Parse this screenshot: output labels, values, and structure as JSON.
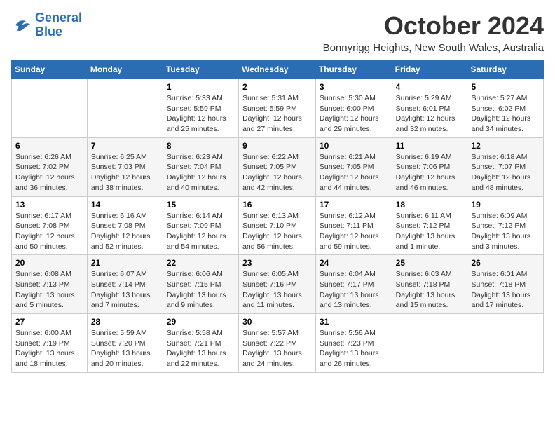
{
  "logo": {
    "line1": "General",
    "line2": "Blue"
  },
  "title": "October 2024",
  "location": "Bonnyrigg Heights, New South Wales, Australia",
  "days_header": [
    "Sunday",
    "Monday",
    "Tuesday",
    "Wednesday",
    "Thursday",
    "Friday",
    "Saturday"
  ],
  "weeks": [
    [
      {
        "day": "",
        "sunrise": "",
        "sunset": "",
        "daylight": ""
      },
      {
        "day": "",
        "sunrise": "",
        "sunset": "",
        "daylight": ""
      },
      {
        "day": "1",
        "sunrise": "Sunrise: 5:33 AM",
        "sunset": "Sunset: 5:59 PM",
        "daylight": "Daylight: 12 hours and 25 minutes."
      },
      {
        "day": "2",
        "sunrise": "Sunrise: 5:31 AM",
        "sunset": "Sunset: 5:59 PM",
        "daylight": "Daylight: 12 hours and 27 minutes."
      },
      {
        "day": "3",
        "sunrise": "Sunrise: 5:30 AM",
        "sunset": "Sunset: 6:00 PM",
        "daylight": "Daylight: 12 hours and 29 minutes."
      },
      {
        "day": "4",
        "sunrise": "Sunrise: 5:29 AM",
        "sunset": "Sunset: 6:01 PM",
        "daylight": "Daylight: 12 hours and 32 minutes."
      },
      {
        "day": "5",
        "sunrise": "Sunrise: 5:27 AM",
        "sunset": "Sunset: 6:02 PM",
        "daylight": "Daylight: 12 hours and 34 minutes."
      }
    ],
    [
      {
        "day": "6",
        "sunrise": "Sunrise: 6:26 AM",
        "sunset": "Sunset: 7:02 PM",
        "daylight": "Daylight: 12 hours and 36 minutes."
      },
      {
        "day": "7",
        "sunrise": "Sunrise: 6:25 AM",
        "sunset": "Sunset: 7:03 PM",
        "daylight": "Daylight: 12 hours and 38 minutes."
      },
      {
        "day": "8",
        "sunrise": "Sunrise: 6:23 AM",
        "sunset": "Sunset: 7:04 PM",
        "daylight": "Daylight: 12 hours and 40 minutes."
      },
      {
        "day": "9",
        "sunrise": "Sunrise: 6:22 AM",
        "sunset": "Sunset: 7:05 PM",
        "daylight": "Daylight: 12 hours and 42 minutes."
      },
      {
        "day": "10",
        "sunrise": "Sunrise: 6:21 AM",
        "sunset": "Sunset: 7:05 PM",
        "daylight": "Daylight: 12 hours and 44 minutes."
      },
      {
        "day": "11",
        "sunrise": "Sunrise: 6:19 AM",
        "sunset": "Sunset: 7:06 PM",
        "daylight": "Daylight: 12 hours and 46 minutes."
      },
      {
        "day": "12",
        "sunrise": "Sunrise: 6:18 AM",
        "sunset": "Sunset: 7:07 PM",
        "daylight": "Daylight: 12 hours and 48 minutes."
      }
    ],
    [
      {
        "day": "13",
        "sunrise": "Sunrise: 6:17 AM",
        "sunset": "Sunset: 7:08 PM",
        "daylight": "Daylight: 12 hours and 50 minutes."
      },
      {
        "day": "14",
        "sunrise": "Sunrise: 6:16 AM",
        "sunset": "Sunset: 7:08 PM",
        "daylight": "Daylight: 12 hours and 52 minutes."
      },
      {
        "day": "15",
        "sunrise": "Sunrise: 6:14 AM",
        "sunset": "Sunset: 7:09 PM",
        "daylight": "Daylight: 12 hours and 54 minutes."
      },
      {
        "day": "16",
        "sunrise": "Sunrise: 6:13 AM",
        "sunset": "Sunset: 7:10 PM",
        "daylight": "Daylight: 12 hours and 56 minutes."
      },
      {
        "day": "17",
        "sunrise": "Sunrise: 6:12 AM",
        "sunset": "Sunset: 7:11 PM",
        "daylight": "Daylight: 12 hours and 59 minutes."
      },
      {
        "day": "18",
        "sunrise": "Sunrise: 6:11 AM",
        "sunset": "Sunset: 7:12 PM",
        "daylight": "Daylight: 13 hours and 1 minute."
      },
      {
        "day": "19",
        "sunrise": "Sunrise: 6:09 AM",
        "sunset": "Sunset: 7:12 PM",
        "daylight": "Daylight: 13 hours and 3 minutes."
      }
    ],
    [
      {
        "day": "20",
        "sunrise": "Sunrise: 6:08 AM",
        "sunset": "Sunset: 7:13 PM",
        "daylight": "Daylight: 13 hours and 5 minutes."
      },
      {
        "day": "21",
        "sunrise": "Sunrise: 6:07 AM",
        "sunset": "Sunset: 7:14 PM",
        "daylight": "Daylight: 13 hours and 7 minutes."
      },
      {
        "day": "22",
        "sunrise": "Sunrise: 6:06 AM",
        "sunset": "Sunset: 7:15 PM",
        "daylight": "Daylight: 13 hours and 9 minutes."
      },
      {
        "day": "23",
        "sunrise": "Sunrise: 6:05 AM",
        "sunset": "Sunset: 7:16 PM",
        "daylight": "Daylight: 13 hours and 11 minutes."
      },
      {
        "day": "24",
        "sunrise": "Sunrise: 6:04 AM",
        "sunset": "Sunset: 7:17 PM",
        "daylight": "Daylight: 13 hours and 13 minutes."
      },
      {
        "day": "25",
        "sunrise": "Sunrise: 6:03 AM",
        "sunset": "Sunset: 7:18 PM",
        "daylight": "Daylight: 13 hours and 15 minutes."
      },
      {
        "day": "26",
        "sunrise": "Sunrise: 6:01 AM",
        "sunset": "Sunset: 7:18 PM",
        "daylight": "Daylight: 13 hours and 17 minutes."
      }
    ],
    [
      {
        "day": "27",
        "sunrise": "Sunrise: 6:00 AM",
        "sunset": "Sunset: 7:19 PM",
        "daylight": "Daylight: 13 hours and 18 minutes."
      },
      {
        "day": "28",
        "sunrise": "Sunrise: 5:59 AM",
        "sunset": "Sunset: 7:20 PM",
        "daylight": "Daylight: 13 hours and 20 minutes."
      },
      {
        "day": "29",
        "sunrise": "Sunrise: 5:58 AM",
        "sunset": "Sunset: 7:21 PM",
        "daylight": "Daylight: 13 hours and 22 minutes."
      },
      {
        "day": "30",
        "sunrise": "Sunrise: 5:57 AM",
        "sunset": "Sunset: 7:22 PM",
        "daylight": "Daylight: 13 hours and 24 minutes."
      },
      {
        "day": "31",
        "sunrise": "Sunrise: 5:56 AM",
        "sunset": "Sunset: 7:23 PM",
        "daylight": "Daylight: 13 hours and 26 minutes."
      },
      {
        "day": "",
        "sunrise": "",
        "sunset": "",
        "daylight": ""
      },
      {
        "day": "",
        "sunrise": "",
        "sunset": "",
        "daylight": ""
      }
    ]
  ]
}
